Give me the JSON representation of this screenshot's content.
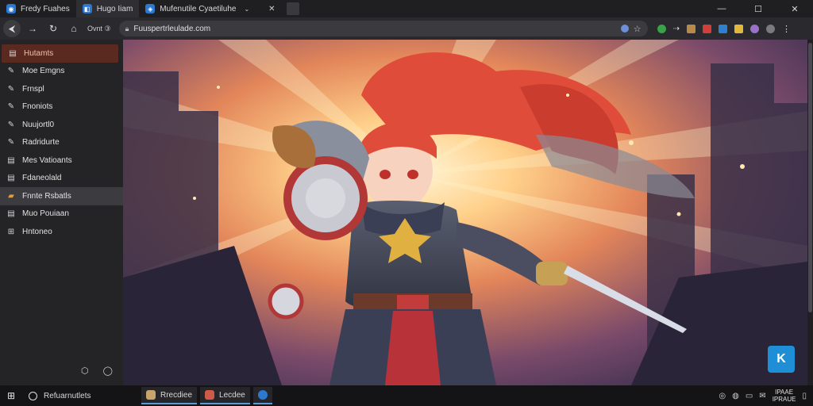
{
  "tabs": [
    {
      "label": "Fredy Fuahes",
      "color": "#2b79d0",
      "glyph": "◉",
      "active": false
    },
    {
      "label": "Hugo Iiam",
      "color": "#2b79d0",
      "glyph": "◧",
      "active": true
    },
    {
      "label": "Mufenutile Cyaetiluhe",
      "color": "#2b79d0",
      "glyph": "◈",
      "active": false
    }
  ],
  "window_controls": {
    "minimize": "—",
    "maximize": "☐",
    "close": "✕"
  },
  "nav": {
    "back_icon": "back-arrow-icon",
    "new_label": "Ovnt ③",
    "url": "Fuuspertrleulade.com"
  },
  "sidebar": {
    "items": [
      {
        "label": "Hutamts",
        "icon": "▤",
        "state": "active"
      },
      {
        "label": "Moe Emgns",
        "icon": "✎",
        "state": ""
      },
      {
        "label": "Frnspl",
        "icon": "✎",
        "state": ""
      },
      {
        "label": "Fnoniots",
        "icon": "✎",
        "state": ""
      },
      {
        "label": "Nuujortl0",
        "icon": "✎",
        "state": ""
      },
      {
        "label": "Radridurte",
        "icon": "✎",
        "state": ""
      },
      {
        "label": "Mes Vatioants",
        "icon": "▤",
        "state": ""
      },
      {
        "label": "Fdaneolald",
        "icon": "▤",
        "state": ""
      },
      {
        "label": "Fnnte Rsbatls",
        "icon": "▸",
        "state": "hover"
      },
      {
        "label": "Muo Pouiaan",
        "icon": "▤",
        "state": ""
      },
      {
        "label": "Hntoneo",
        "icon": "⊞",
        "state": ""
      }
    ]
  },
  "taskbar": {
    "search_label": "Refuarnutlets",
    "tasks": [
      {
        "label": "Rrecdiee",
        "color": "#c9a36b"
      },
      {
        "label": "Lecdee",
        "color": "#d05a4a"
      },
      {
        "label": "",
        "color": "#2b79d0"
      }
    ],
    "clock_line1": "IPAAE",
    "clock_line2": "IPRAUE"
  },
  "colors": {
    "accent": "#1e8fd6",
    "active_sidebar": "#5a2a20"
  }
}
